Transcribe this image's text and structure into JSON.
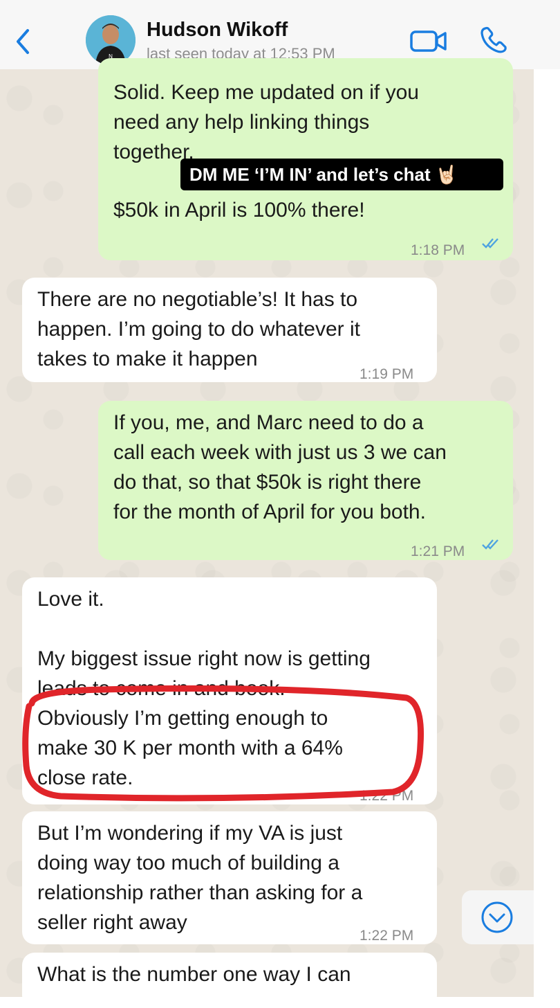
{
  "header": {
    "contact_name": "Hudson Wikoff",
    "last_seen": "last seen today at 12:53 PM",
    "back_icon": "chevron-left-icon",
    "video_icon": "video-camera-icon",
    "phone_icon": "phone-icon",
    "accent_color": "#1a7de0"
  },
  "overlay": {
    "text": "DM ME ‘I’M IN’ and let’s chat 🤘🏻"
  },
  "messages": [
    {
      "direction": "outgoing",
      "text": "Solid. Keep me updated on if you\nneed any help linking things\ntogether.",
      "text2": "$50k in April is 100% there!",
      "time": "1:18 PM",
      "read": true
    },
    {
      "direction": "incoming",
      "text": "There are no negotiable’s! It has to\nhappen. I’m going to do whatever it\ntakes to make it happen",
      "time": "1:19 PM"
    },
    {
      "direction": "outgoing",
      "text": "If you, me, and Marc need to do a\ncall each week with just us 3 we can\ndo that, so that $50k is right there\nfor the month of April for you both.",
      "time": "1:21 PM",
      "read": true
    },
    {
      "direction": "incoming",
      "text": "Love it.\n\nMy biggest issue right now is getting\nleads to come in and book.\nObviously I’m getting enough to\nmake 30 K per month with a 64%\nclose rate.",
      "time": "1:22 PM"
    },
    {
      "direction": "incoming",
      "text": "But I’m wondering if my VA is just\ndoing way too much of building a\nrelationship rather than asking for a\nseller right away",
      "time": "1:22 PM"
    },
    {
      "direction": "incoming",
      "text": "What is the number one way I can"
    }
  ],
  "colors": {
    "outgoing_bubble": "#dcf8c6",
    "incoming_bubble": "#ffffff",
    "chat_background": "#ebe5dc",
    "read_ticks": "#4fa3e0",
    "highlight_ring": "#e0252a"
  },
  "scroll_button_icon": "chevron-down-circle-icon"
}
